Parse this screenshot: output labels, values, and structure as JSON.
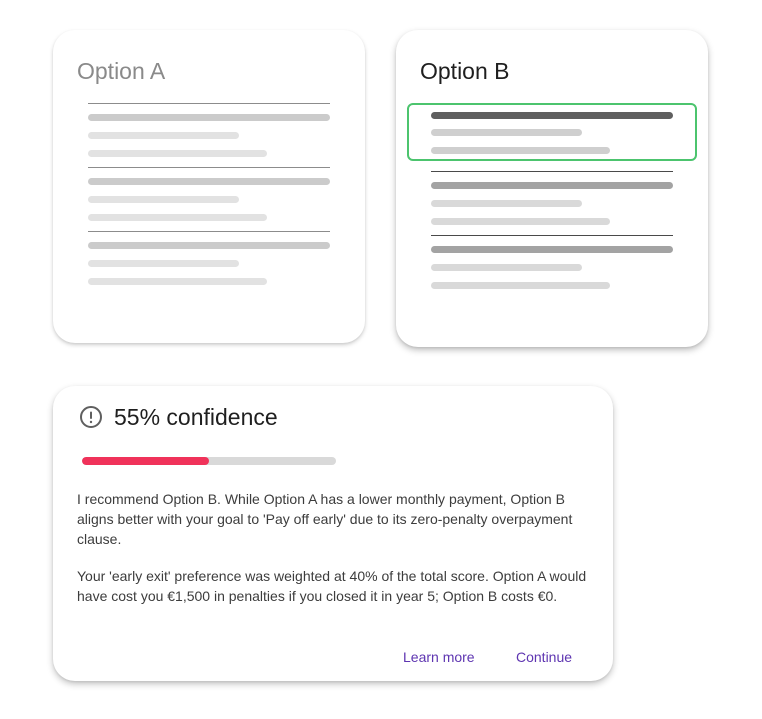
{
  "option_a": {
    "title": "Option A"
  },
  "option_b": {
    "title": "Option B"
  },
  "confidence": {
    "title": "55% confidence",
    "level_percent": 50,
    "icon": "alert-circle-icon",
    "paragraph_1": "I recommend Option B. While Option A has a lower monthly payment, Option B aligns better with your goal to 'Pay off early' due to its zero-penalty overpayment clause.",
    "paragraph_2": "Your 'early exit' preference was weighted at 40% of the total score. Option A would have cost you €1,500 in penalties if you closed it in year 5; Option B costs €0.",
    "learn_more_label": "Learn more",
    "continue_label": "Continue"
  },
  "colors": {
    "accent": "#5e35b1",
    "progress_fill": "#f0325a",
    "progress_track": "#d9d9d9",
    "highlight_border": "#4cc46e"
  }
}
